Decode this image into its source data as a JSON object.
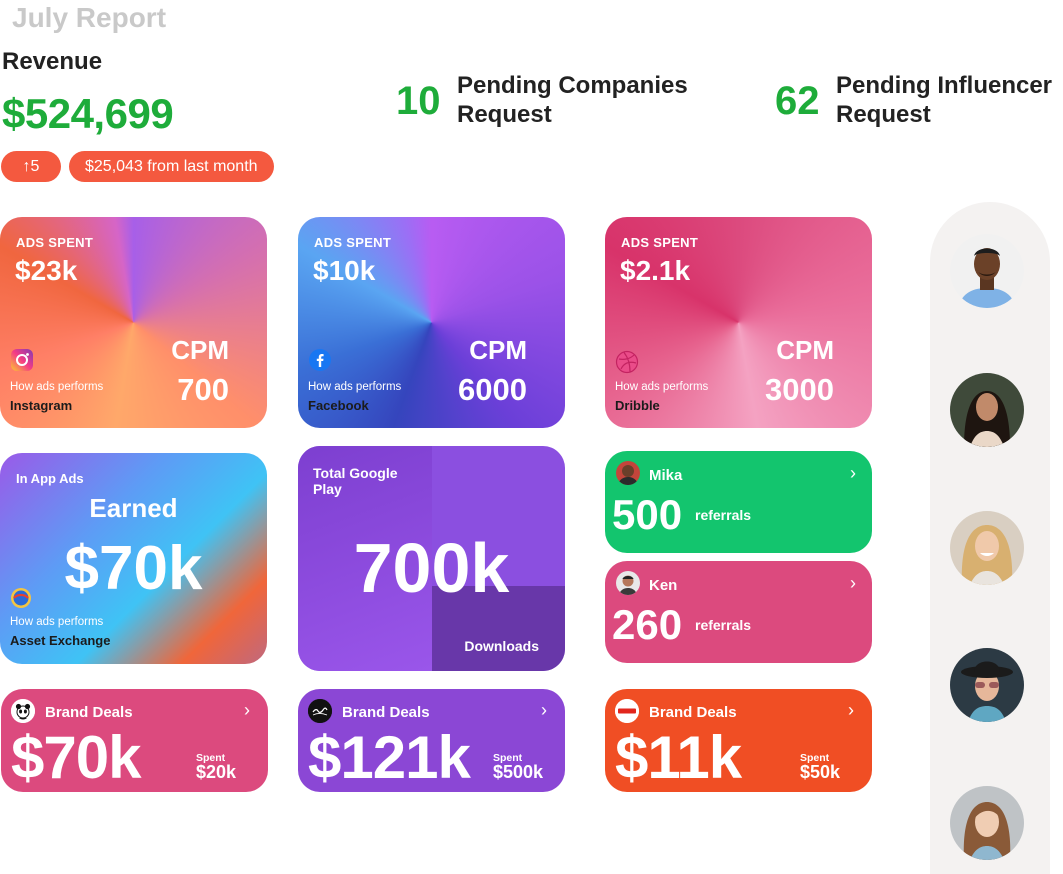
{
  "header": {
    "title": "July Report",
    "revenue_label": "Revenue",
    "revenue_value": "$524,699",
    "change_count": "5",
    "change_text": "$25,043 from last month"
  },
  "pending": [
    {
      "count": "10",
      "label_line1": "Pending Companies",
      "label_line2": "Request"
    },
    {
      "count": "62",
      "label_line1": "Pending Influencer",
      "label_line2": "Request"
    }
  ],
  "ads_cards": [
    {
      "label": "ADS SPENT",
      "value": "$23k",
      "cpm_label": "CPM",
      "cpm_value": "700",
      "perf_label": "How ads performs",
      "platform": "Instagram",
      "icon": "instagram-icon"
    },
    {
      "label": "ADS SPENT",
      "value": "$10k",
      "cpm_label": "CPM",
      "cpm_value": "6000",
      "perf_label": "How ads performs",
      "platform": "Facebook",
      "icon": "facebook-icon"
    },
    {
      "label": "ADS SPENT",
      "value": "$2.1k",
      "cpm_label": "CPM",
      "cpm_value": "3000",
      "perf_label": "How ads performs",
      "platform": "Dribble",
      "icon": "dribbble-icon"
    }
  ],
  "in_app": {
    "title": "In App Ads",
    "earned_label": "Earned",
    "value": "$70k",
    "perf_label": "How ads performs",
    "platform": "Asset Exchange",
    "icon": "asset-exchange-icon"
  },
  "google_play": {
    "title": "Total Google Play",
    "value": "700k",
    "sub_label": "Downloads"
  },
  "referrals": [
    {
      "name": "Mika",
      "count": "500",
      "unit": "referrals",
      "color": "#13c56e"
    },
    {
      "name": "Ken",
      "count": "260",
      "unit": "referrals",
      "color": "#dc4a7e"
    }
  ],
  "brand_deals": [
    {
      "label": "Brand Deals",
      "value": "$70k",
      "spent_label": "Spent",
      "spent_value": "$20k",
      "logo": "wwf-panda-icon",
      "color": "#dc4a7e"
    },
    {
      "label": "Brand Deals",
      "value": "$121k",
      "spent_label": "Spent",
      "spent_value": "$500k",
      "logo": "coca-cola-icon",
      "color": "#8b47d5"
    },
    {
      "label": "Brand Deals",
      "value": "$11k",
      "spent_label": "Spent",
      "spent_value": "$50k",
      "logo": "canon-icon",
      "color": "#f04e24"
    }
  ],
  "colors": {
    "green": "#1eac3a",
    "accent_red": "#f4593f"
  }
}
